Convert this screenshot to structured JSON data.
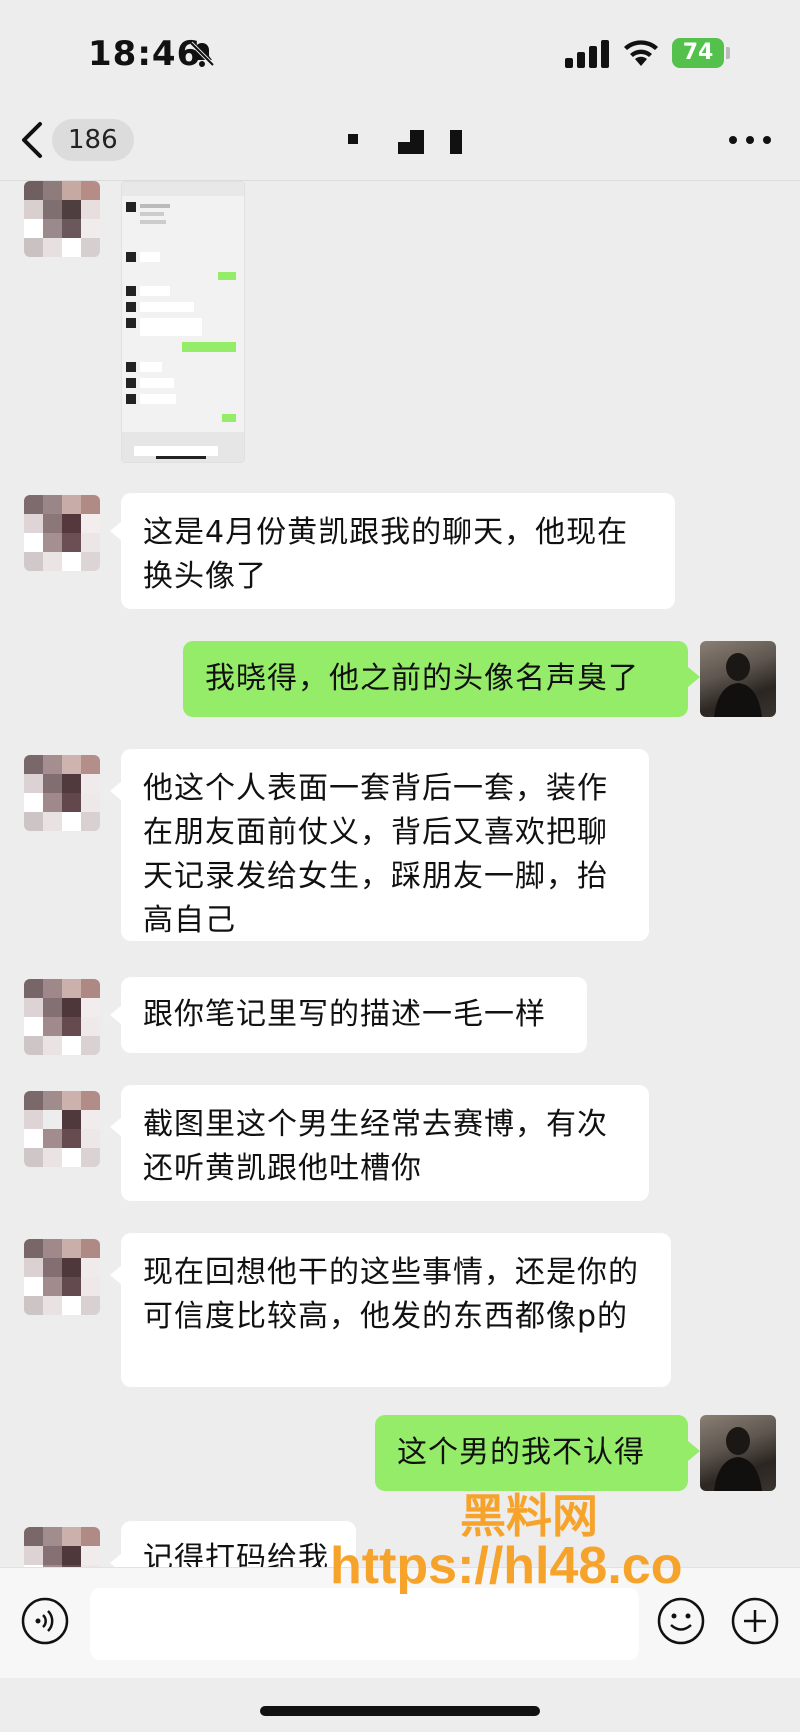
{
  "status_bar": {
    "time": "18:46",
    "battery": "74"
  },
  "nav": {
    "unread_count": "186",
    "title": ""
  },
  "messages": [
    {
      "from": "contact",
      "type": "image"
    },
    {
      "from": "contact",
      "text": "这是4月份黄凯跟我的聊天，他现在换头像了"
    },
    {
      "from": "me",
      "text": "我晓得，他之前的头像名声臭了"
    },
    {
      "from": "contact",
      "text": "他这个人表面一套背后一套，装作在朋友面前仗义，背后又喜欢把聊天记录发给女生，踩朋友一脚，抬高自己"
    },
    {
      "from": "contact",
      "text": "跟你笔记里写的描述一毛一样"
    },
    {
      "from": "contact",
      "text": "截图里这个男生经常去赛博，有次还听黄凯跟他吐槽你"
    },
    {
      "from": "contact",
      "text": "现在回想他干的这些事情，还是你的可信度比较高，他发的东西都像p的"
    },
    {
      "from": "me",
      "text": "这个男的我不认得"
    },
    {
      "from": "contact",
      "text": "记得打码给我"
    }
  ],
  "input": {
    "placeholder": ""
  },
  "watermark": {
    "name": "黑料网",
    "url": "https://hl48.co"
  },
  "icons": {
    "back": "chevron-left-icon",
    "more": "more-dots-icon",
    "voice": "voice-icon",
    "emoji": "emoji-icon",
    "add": "plus-icon",
    "mute": "bell-slash-icon"
  },
  "colors": {
    "background": "#ededed",
    "bubble_out": "#95ec69",
    "bubble_in": "#ffffff",
    "battery": "#53c14b",
    "watermark": "#f6a32b"
  }
}
